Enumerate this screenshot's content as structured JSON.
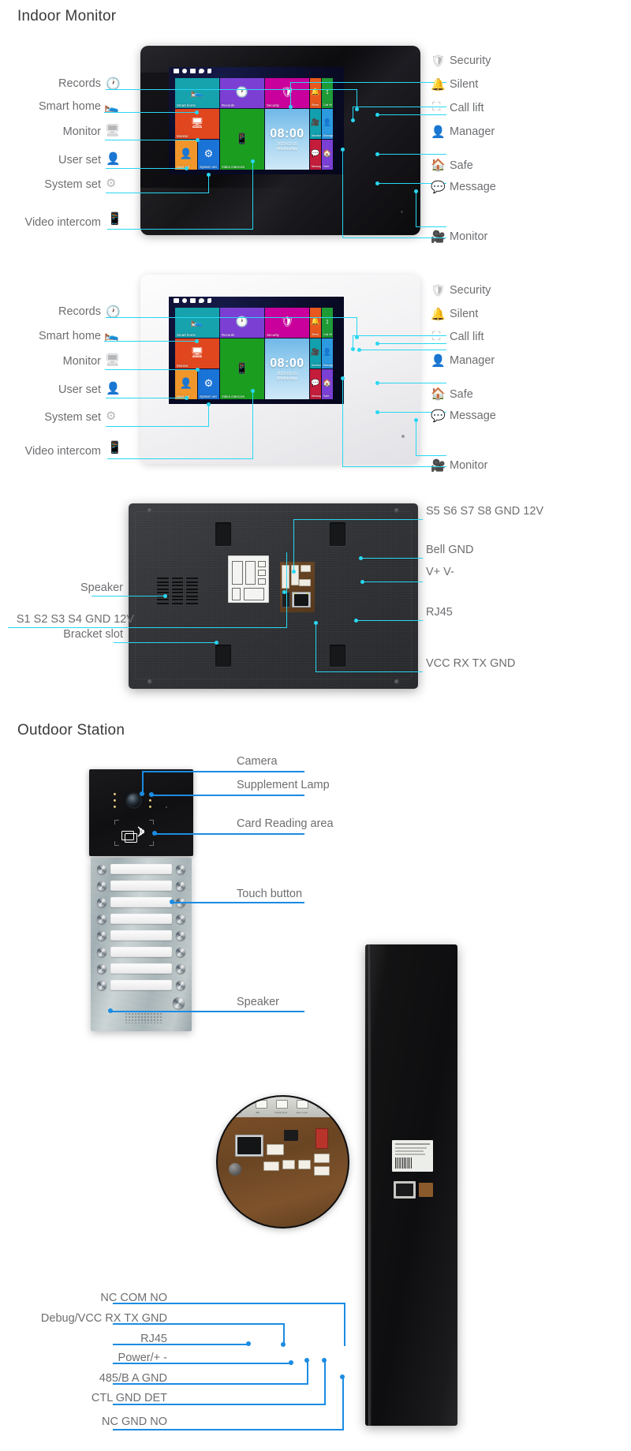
{
  "sections": {
    "indoor_title": "Indoor Monitor",
    "outdoor_title": "Outdoor Station"
  },
  "monitor_ui": {
    "clock": {
      "time": "08:00",
      "date": "2023-02-15",
      "day": "Wednesday"
    },
    "tiles": [
      {
        "name": "Smart home",
        "color": "#16a3ad",
        "glyph": "smart-home-icon"
      },
      {
        "name": "Records",
        "color": "#7c3fd4",
        "glyph": "records-icon"
      },
      {
        "name": "Security",
        "color": "#c9009b",
        "glyph": "security-icon"
      },
      {
        "name": "Monitor",
        "color": "#e0471f",
        "glyph": "monitor-icon"
      },
      {
        "name": "Video intercom",
        "color": "#1b9e20",
        "glyph": "video-intercom-icon"
      },
      {
        "name": "User set",
        "color": "#f0962a",
        "glyph": "user-set-icon"
      },
      {
        "name": "System set",
        "color": "#1a73d6",
        "glyph": "system-set-icon"
      },
      {
        "name": "Silent",
        "color": "#e8581e",
        "glyph": "silent-icon"
      },
      {
        "name": "Call lift",
        "color": "#1f9b36",
        "glyph": "call-lift-icon"
      },
      {
        "name": "Monitor",
        "color": "#12a0ae",
        "glyph": "camera-monitor-icon"
      },
      {
        "name": "Manager",
        "color": "#2b9ae0",
        "glyph": "manager-icon"
      },
      {
        "name": "Message",
        "color": "#c41c3b",
        "glyph": "message-icon"
      },
      {
        "name": "Safe",
        "color": "#7a3fd4",
        "glyph": "safe-icon"
      }
    ]
  },
  "monitor1": {
    "left_labels": [
      {
        "text": "Records",
        "icon": "clock-icon"
      },
      {
        "text": "Smart home",
        "icon": "sofa-icon"
      },
      {
        "text": "Monitor",
        "icon": "network-icon"
      },
      {
        "text": "User set",
        "icon": "person-icon"
      },
      {
        "text": "System set",
        "icon": "gear-icon"
      },
      {
        "text": "Video intercom",
        "icon": "handset-icon"
      }
    ],
    "right_labels": [
      {
        "text": "Security",
        "icon": "shield-check-icon"
      },
      {
        "text": "Silent",
        "icon": "bell-icon"
      },
      {
        "text": "Call lift",
        "icon": "elevator-icon"
      },
      {
        "text": "Manager",
        "icon": "person-icon"
      },
      {
        "text": "Safe",
        "icon": "house-icon"
      },
      {
        "text": "Message",
        "icon": "chat-icon"
      },
      {
        "text": "Monitor",
        "icon": "camera-icon"
      }
    ]
  },
  "monitor2": {
    "left_labels": [
      {
        "text": "Records",
        "icon": "clock-icon"
      },
      {
        "text": "Smart home",
        "icon": "sofa-icon"
      },
      {
        "text": "Monitor",
        "icon": "network-icon"
      },
      {
        "text": "User set",
        "icon": "person-icon"
      },
      {
        "text": "System set",
        "icon": "gear-icon"
      },
      {
        "text": "Video intercom",
        "icon": "handset-icon"
      }
    ],
    "right_labels": [
      {
        "text": "Security",
        "icon": "shield-check-icon"
      },
      {
        "text": "Silent",
        "icon": "bell-icon"
      },
      {
        "text": "Call lift",
        "icon": "elevator-icon"
      },
      {
        "text": "Manager",
        "icon": "person-icon"
      },
      {
        "text": "Safe",
        "icon": "house-icon"
      },
      {
        "text": "Message",
        "icon": "chat-icon"
      },
      {
        "text": "Monitor",
        "icon": "camera-icon"
      }
    ]
  },
  "back_panel": {
    "left_labels": [
      {
        "text": "S1 S2 S3 S4 GND 12V"
      },
      {
        "text": "Speaker"
      },
      {
        "text": "Bracket slot"
      }
    ],
    "right_labels": [
      {
        "text": "S5 S6 S7 S8 GND 12V"
      },
      {
        "text": "Bell GND"
      },
      {
        "text": "V+ V-"
      },
      {
        "text": "RJ45"
      },
      {
        "text": "VCC RX TX GND"
      }
    ]
  },
  "outdoor_station": {
    "right_labels": [
      {
        "text": "Camera"
      },
      {
        "text": "Supplement Lamp"
      },
      {
        "text": "Card Reading area"
      },
      {
        "text": "Touch button"
      },
      {
        "text": "Speaker"
      }
    ],
    "button_count": 8
  },
  "outdoor_pcb": {
    "left_labels": [
      {
        "text": "NC COM NO"
      },
      {
        "text": "Debug/VCC RX TX GND"
      },
      {
        "text": "RJ45"
      },
      {
        "text": "Power/+ -"
      },
      {
        "text": "485/B A GND"
      },
      {
        "text": "CTL GND DET"
      },
      {
        "text": "NC GND NO"
      }
    ]
  },
  "colors": {
    "leader_cyan": "#28d7f2",
    "leader_blue": "#1b8ce3",
    "label_gray": "#6d6e71",
    "title_gray": "#3a3a3a"
  }
}
